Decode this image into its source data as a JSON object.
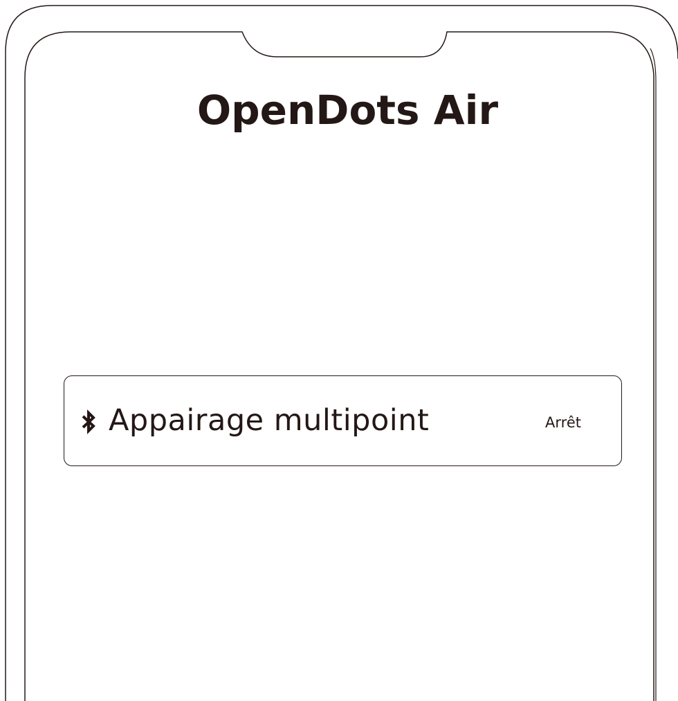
{
  "app": {
    "title": "OpenDots Air"
  },
  "settings": {
    "multipoint": {
      "icon": "bluetooth-icon",
      "label": "Appairage multipoint",
      "value": "Arrêt"
    }
  },
  "colors": {
    "text": "#231815",
    "outline": "#231815",
    "background": "#ffffff"
  }
}
